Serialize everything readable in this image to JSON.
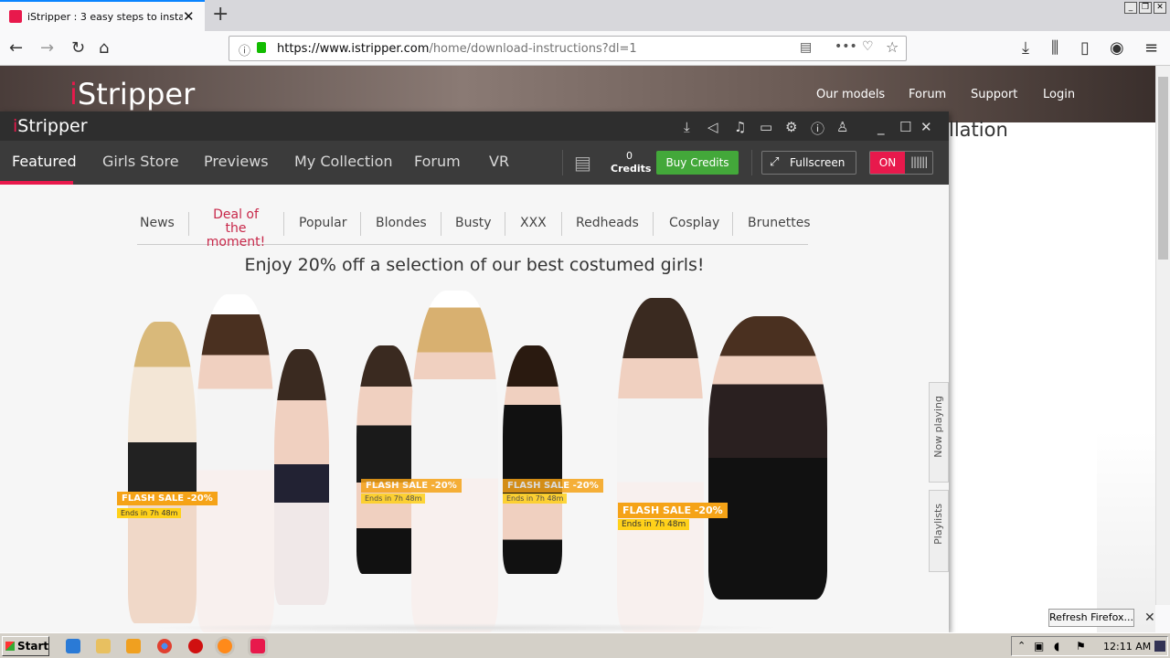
{
  "browser": {
    "tab_title": "iStripper : 3 easy steps to install iS",
    "new_tab": "+",
    "url_host": "https://www.istripper.com",
    "url_path": "/home/download-instructions?dl=1"
  },
  "site": {
    "logo_i": "i",
    "logo_rest": "Stripper",
    "nav": [
      "Our models",
      "Forum",
      "Support",
      "Login"
    ],
    "partial_text": "llation"
  },
  "app": {
    "logo_i": "i",
    "logo_rest": "Stripper",
    "menu": [
      "Featured",
      "Girls Store",
      "Previews",
      "My Collection",
      "Forum",
      "VR"
    ],
    "credits_count": "0",
    "credits_label": "Credits",
    "buy_credits": "Buy Credits",
    "fullscreen": "Fullscreen",
    "toggle_on": "ON",
    "subnav": [
      "News",
      "Deal of the moment!",
      "Popular",
      "Blondes",
      "Busty",
      "XXX",
      "Redheads",
      "Cosplay",
      "Brunettes"
    ],
    "headline": "Enjoy 20% off a selection of our best costumed girls!",
    "flash_sale": "FLASH SALE -20%",
    "ends_in": "Ends in 7h 48m",
    "side_tabs": [
      "Now playing",
      "Playlists"
    ]
  },
  "notification": {
    "refresh_button": "Refresh Firefox..."
  },
  "taskbar": {
    "start": "Start",
    "clock": "12:11 AM"
  },
  "colors": {
    "brand_pink": "#e8194c",
    "buy_green": "#43a83a",
    "sale_orange": "#f5a317"
  }
}
